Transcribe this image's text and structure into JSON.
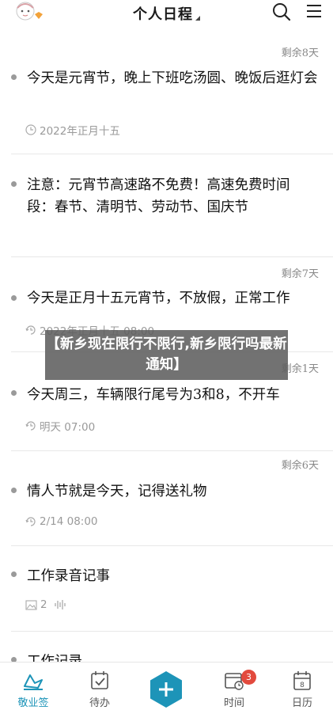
{
  "header": {
    "title": "个人日程",
    "avatar_icon": "cartoon-avatar-icon",
    "search_icon": "search-icon",
    "menu_icon": "menu-icon"
  },
  "items": [
    {
      "remaining": "剩余8天",
      "text": "今天是元宵节，晚上下班吃汤圆、晚饭后逛灯会",
      "meta": "2022年正月十五",
      "meta_icon": "clock-icon"
    },
    {
      "remaining": "",
      "text": "注意：元宵节高速路不免费！高速免费时间段：春节、清明节、劳动节、国庆节",
      "meta": "",
      "meta_icon": ""
    },
    {
      "remaining": "剩余7天",
      "text": "今天是正月十五元宵节，不放假，正常工作",
      "meta": "2022年正月十五 08:00",
      "meta_icon": "repeat-clock-icon"
    },
    {
      "remaining": "剩余1天",
      "text": "今天周三，车辆限行尾号为3和8，不开车",
      "meta": "明天 07:00",
      "meta_icon": "repeat-clock-icon"
    },
    {
      "remaining": "剩余6天",
      "text": "情人节就是今天，记得送礼物",
      "meta": "2/14 08:00",
      "meta_icon": "repeat-clock-icon"
    },
    {
      "remaining": "",
      "text": "工作录音记事",
      "meta": "2",
      "meta_icon": "image-icon"
    },
    {
      "remaining": "",
      "text": "工作记录",
      "meta": "",
      "meta_icon": ""
    }
  ],
  "overlay": {
    "text": "【新乡现在限行不限行,新乡限行吗最新通知】"
  },
  "tabs": [
    {
      "label": "敬业签",
      "icon": "sign-icon",
      "active": true
    },
    {
      "label": "待办",
      "icon": "todo-check-icon",
      "active": false
    },
    {
      "label": "",
      "icon": "add-icon",
      "active": false
    },
    {
      "label": "时间",
      "icon": "calendar-time-icon",
      "active": false,
      "badge": "3"
    },
    {
      "label": "日历",
      "icon": "calendar-icon",
      "active": false,
      "day": "8"
    }
  ],
  "colors": {
    "accent": "#1d94b8",
    "badge": "#e24a3d",
    "text": "#111111",
    "muted": "#9a9a9a"
  }
}
